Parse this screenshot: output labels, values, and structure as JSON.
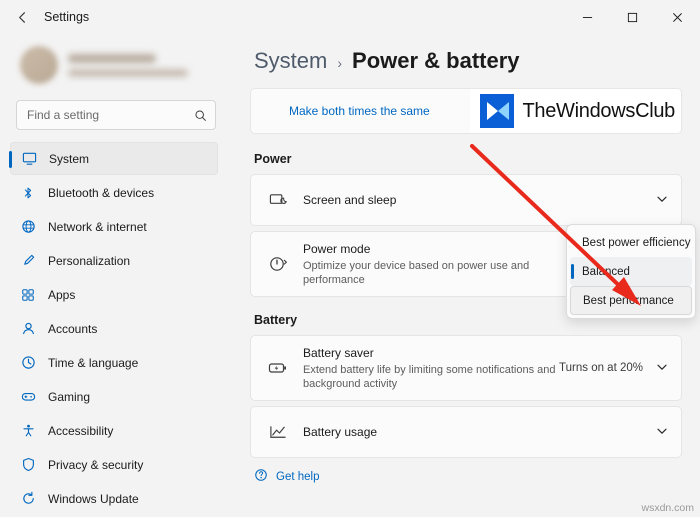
{
  "window": {
    "title": "Settings",
    "back_icon": "back-arrow-icon",
    "minimize_label": "─",
    "maximize_label": "☐",
    "close_label": "✕"
  },
  "sidebar": {
    "search": {
      "placeholder": "Find a setting",
      "value": "",
      "icon": "search-icon"
    },
    "items": [
      {
        "label": "System",
        "icon": "monitor-icon",
        "selected": true
      },
      {
        "label": "Bluetooth & devices",
        "icon": "bluetooth-icon",
        "selected": false
      },
      {
        "label": "Network & internet",
        "icon": "globe-icon",
        "selected": false
      },
      {
        "label": "Personalization",
        "icon": "brush-icon",
        "selected": false
      },
      {
        "label": "Apps",
        "icon": "apps-icon",
        "selected": false
      },
      {
        "label": "Accounts",
        "icon": "account-icon",
        "selected": false
      },
      {
        "label": "Time & language",
        "icon": "clock-icon",
        "selected": false
      },
      {
        "label": "Gaming",
        "icon": "gamepad-icon",
        "selected": false
      },
      {
        "label": "Accessibility",
        "icon": "accessibility-icon",
        "selected": false
      },
      {
        "label": "Privacy & security",
        "icon": "shield-icon",
        "selected": false
      },
      {
        "label": "Windows Update",
        "icon": "update-icon",
        "selected": false
      }
    ]
  },
  "main": {
    "breadcrumb": {
      "root": "System",
      "separator": "›",
      "current": "Power & battery"
    },
    "banner": {
      "link": "Make both times the same",
      "close_icon": "close-icon",
      "watermark_text": "TheWindowsClub"
    },
    "sections": [
      {
        "heading": "Power",
        "cards": [
          {
            "icon": "screen-sleep-icon",
            "title": "Screen and sleep",
            "subtitle": "",
            "right": "",
            "chevron": "⌄"
          },
          {
            "icon": "power-mode-icon",
            "title": "Power mode",
            "subtitle": "Optimize your device based on power use and performance",
            "right": "",
            "chevron": ""
          }
        ]
      },
      {
        "heading": "Battery",
        "cards": [
          {
            "icon": "battery-saver-icon",
            "title": "Battery saver",
            "subtitle": "Extend battery life by limiting some notifications and background activity",
            "right": "Turns on at 20%",
            "chevron": "⌄"
          },
          {
            "icon": "battery-usage-icon",
            "title": "Battery usage",
            "subtitle": "",
            "right": "",
            "chevron": "⌄"
          }
        ]
      }
    ],
    "help": {
      "icon": "help-icon",
      "label": "Get help"
    }
  },
  "dropdown": {
    "options": [
      {
        "label": "Best power efficiency",
        "state": "normal"
      },
      {
        "label": "Balanced",
        "state": "selected"
      },
      {
        "label": "Best performance",
        "state": "hover"
      }
    ]
  },
  "annotation": {
    "arrow_color": "#e8291c"
  },
  "corner_watermark": "wsxdn.com",
  "colors": {
    "accent": "#0067c0",
    "window_bg": "#f3f3f3",
    "card_bg": "#fbfbfb"
  }
}
